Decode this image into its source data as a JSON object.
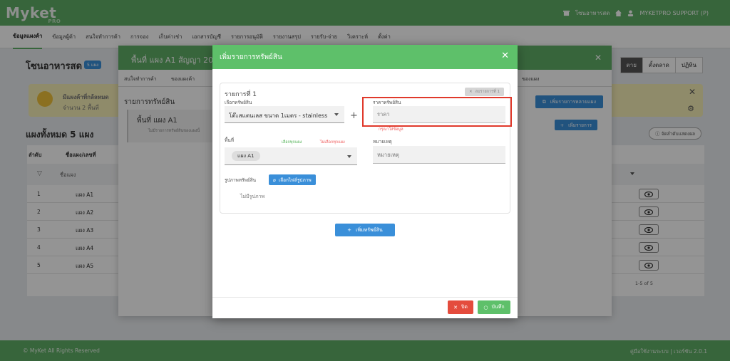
{
  "app": {
    "logo": "Myket",
    "logo_sub": "PRO",
    "shop_name_top": "โซนอาหารสด",
    "user": "MYKETPRO SUPPORT (P)"
  },
  "nav": {
    "items": [
      "ข้อมูลแผงค้า",
      "ข้อมูลผู้ค้า",
      "สนใจทำการค้า",
      "การจอง",
      "เก็บค่าเช่า",
      "เอกสารบัญชี",
      "รายการอนุมัติ",
      "รายงานสรุป",
      "รายรับ-จ่าย",
      "วิเคราะห์",
      "ตั้งค่า"
    ]
  },
  "page": {
    "shop_title": "โซนอาหารสด",
    "shop_badge": "5 แผง",
    "right_tabs": [
      "ตาย",
      "ตั้งตลาด",
      "ปฏิทิน"
    ],
    "warn_text1": "มีแผงค้าที่กล้ลหมด",
    "warn_text2": "จำนวน 2 พื้นที่",
    "zones_title": "แผงทั้งหมด 5 แผง",
    "sort_label": "จัดลำดับแสดงผล",
    "grid_col_no": "ลำดับ",
    "grid_col_name": "ชื่อแผง/เลขที่",
    "grid_filter_placeholder": "ชื่อแผง",
    "rows": [
      {
        "no": "1",
        "name": "แผง A1"
      },
      {
        "no": "2",
        "name": "แผง A2"
      },
      {
        "no": "3",
        "name": "แผง A3"
      },
      {
        "no": "4",
        "name": "แผง A4"
      },
      {
        "no": "5",
        "name": "แผง A5"
      }
    ],
    "pager": "1-5 of 5"
  },
  "footer": {
    "left": "© MyKet All Rights Reserved",
    "right": "คู่มือใช้งานระบบ | เวอร์ชัน 2.0.1"
  },
  "zone_modal": {
    "title": "พื้นที่ แผง A1 สัญญา 20",
    "tabs": [
      "สนใจทำการค้า",
      "ของแผงค้า",
      "ของแผง"
    ],
    "assets_title": "รายการทรัพย์สิน",
    "card_title": "พื้นที่ แผง A1",
    "card_sub": "ไม่มีรายการทรัพย์สินของแผงนี้",
    "multi_btn": "เพิ่มรายการหลายแผง",
    "add_list_btn": "เพิ่มรายการ"
  },
  "modal": {
    "title": "เพิ่มรายการทรัพย์สิน",
    "item_title": "รายการที่ 1",
    "delete_item": "ลบรายการที่ 1",
    "select_asset_label": "เลือกทรัพย์สิน",
    "select_asset_value": "โต๊ะสแตนเลส ขนาด 1เมตร - stainless",
    "price_label": "ราคาทรัพย์สิน",
    "price_placeholder": "ราคา",
    "price_hint": "กรุณาใส่ข้อมูล",
    "area_label": "พื้นที่",
    "select_all": "เลือกทุกแผง",
    "deselect_all": "ไม่เลือกทุกแผง",
    "area_chip": "แผง A1",
    "note_label": "หมายเหตุ",
    "note_placeholder": "หมายเหตุ",
    "image_label": "รูปภาพทรัพย์สิน",
    "file_btn": "เลือกไฟล์รูปภาพ",
    "no_image": "ไม่มีรูปภาพ",
    "add_asset_btn": "เพิ่มทรัพย์สิน",
    "close_btn": "ปิด",
    "save_btn": "บันทึก"
  },
  "colors": {
    "brand_green": "#5fae66",
    "modal_green": "#5ec06a",
    "primary_blue": "#3a8fd9",
    "danger_red": "#e44c3d",
    "highlight_red": "#e0392b"
  }
}
